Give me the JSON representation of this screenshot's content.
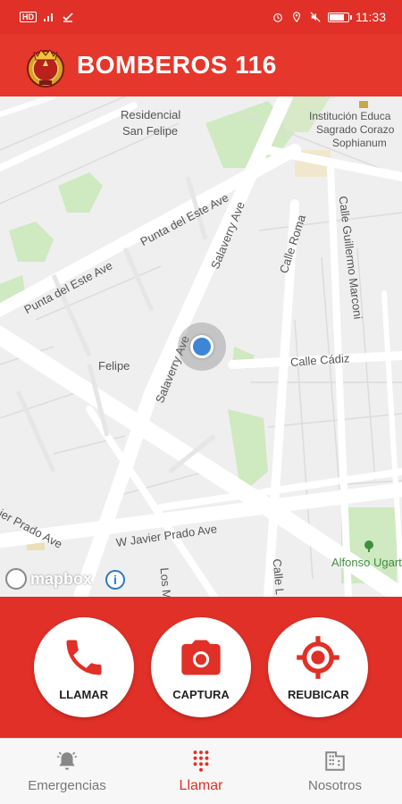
{
  "status_bar": {
    "network": "HD",
    "time": "11:33"
  },
  "app_bar": {
    "title": "BOMBEROS 116"
  },
  "map": {
    "labels": {
      "residencial": "Residencial",
      "san_felipe": "San Felipe",
      "institucion": "Institución Educa",
      "sagrado": "Sagrado Corazo",
      "sophianum": "Sophianum",
      "punta_este_1": "Punta del Este Ave",
      "punta_este_2": "Punta del Este Ave",
      "salaverry_1": "Salaverry Ave",
      "salaverry_2": "Salaverry Ave",
      "calle_roma": "Calle Roma",
      "calle_guillermo": "Calle Guillermo Marconi",
      "calle_cadiz": "Calle Cádiz",
      "felipe": "Felipe",
      "javier_prado_1": "ier Prado Ave",
      "javier_prado_2": "W Javier Prado Ave",
      "los_m": "Los M",
      "calle_l": "Calle L",
      "alfonso": "Alfonso Ugart"
    },
    "attribution": "mapbox"
  },
  "actions": {
    "call": "LLAMAR",
    "capture": "CAPTURA",
    "relocate": "REUBICAR"
  },
  "nav": {
    "emergencies": "Emergencias",
    "call": "Llamar",
    "about": "Nosotros",
    "active": "call"
  },
  "colors": {
    "brand_red": "#e03027",
    "map_blue": "#3d86d6"
  }
}
